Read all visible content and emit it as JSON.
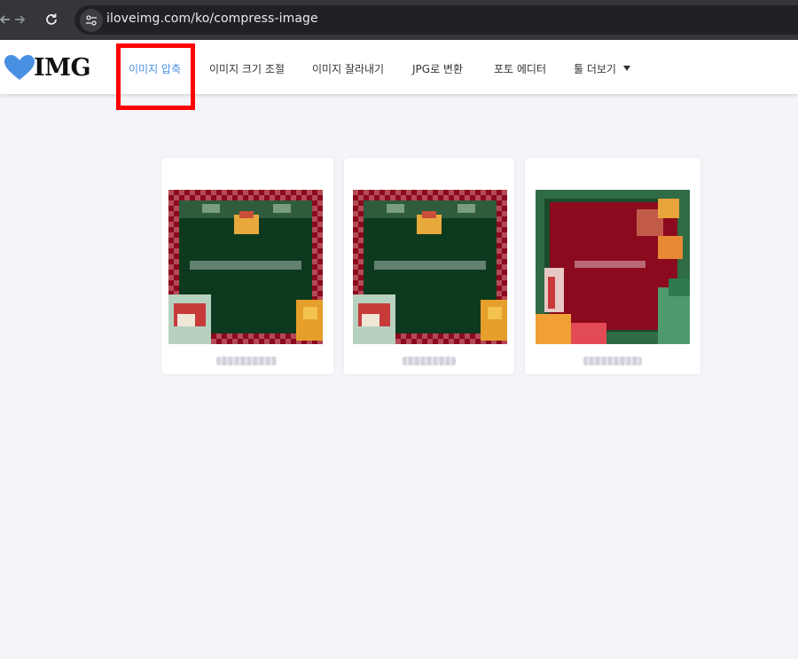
{
  "browser": {
    "url": "iloveimg.com/ko/compress-image",
    "icons": [
      "back-arrow-icon",
      "forward-arrow-icon",
      "reload-icon",
      "site-settings-icon"
    ]
  },
  "logo": {
    "text": "IMG",
    "icon": "heart-icon",
    "accent": "#4a90e2"
  },
  "nav": {
    "items": [
      {
        "label": "이미지 압축",
        "active": true
      },
      {
        "label": "이미지 크기 조절",
        "active": false
      },
      {
        "label": "이미지 잘라내기",
        "active": false
      },
      {
        "label": "JPG로 변환",
        "active": false
      },
      {
        "label": "포토 에디터",
        "active": false
      },
      {
        "label": "툴 더보기",
        "active": false,
        "dropdown": true
      }
    ]
  },
  "colors": {
    "active_nav": "#4a90e2",
    "highlight": "#ff0000",
    "page_bg": "#f4f4f9",
    "card_green": "#0d3a1f",
    "card_red": "#8b0a1e"
  },
  "cards": [
    {
      "theme": "green"
    },
    {
      "theme": "green"
    },
    {
      "theme": "red"
    }
  ]
}
